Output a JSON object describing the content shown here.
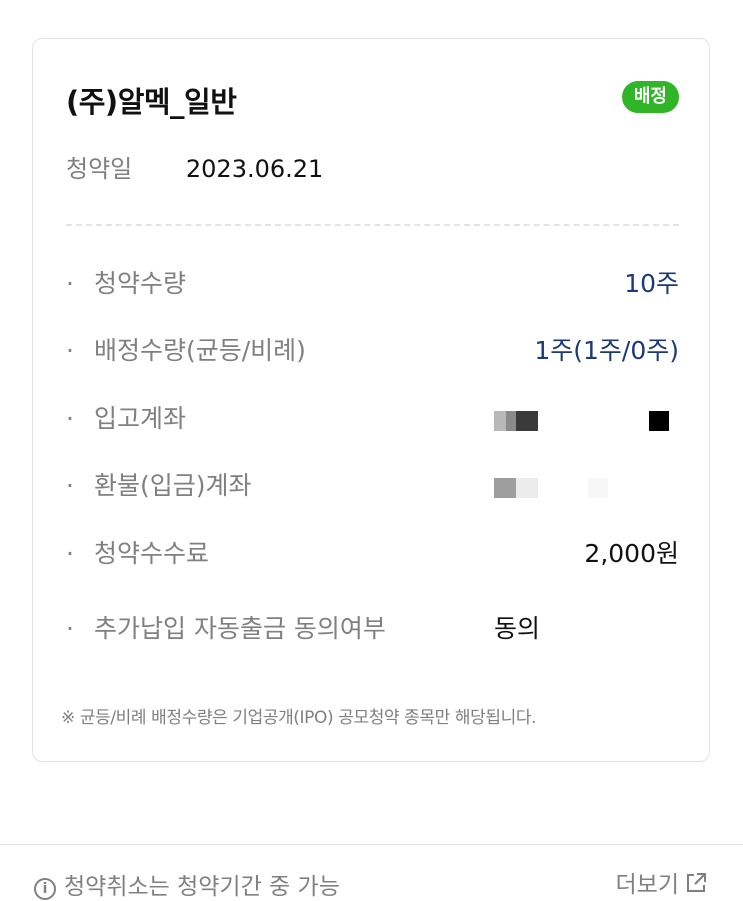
{
  "card": {
    "title": "(주)알멕_일반",
    "status_badge": "배정",
    "date_label": "청약일",
    "date_value": "2023.06.21",
    "rows": [
      {
        "label": "청약수량",
        "value": "10주"
      },
      {
        "label": "배정수량(균등/비례)",
        "value": "1주(1주/0주)"
      },
      {
        "label": "입고계좌",
        "value": ""
      },
      {
        "label": "환불(입금)계좌",
        "value": ""
      },
      {
        "label": "청약수수료",
        "value": "2,000원"
      },
      {
        "label": "추가납입 자동출금 동의여부",
        "value": "동의"
      }
    ],
    "bullet": "·",
    "note": "※ 균등/비례 배정수량은 기업공개(IPO) 공모청약 종목만 해당됩니다."
  },
  "footer": {
    "info_text": "청약취소는 청약기간 중 가능",
    "more_label": "더보기"
  },
  "icons": {
    "info": "info-circle-icon",
    "more": "external-link-icon"
  },
  "colors": {
    "badge": "#2fb527",
    "accent_value": "#1c3a73",
    "label": "#808080",
    "border": "#e3e3e3"
  }
}
